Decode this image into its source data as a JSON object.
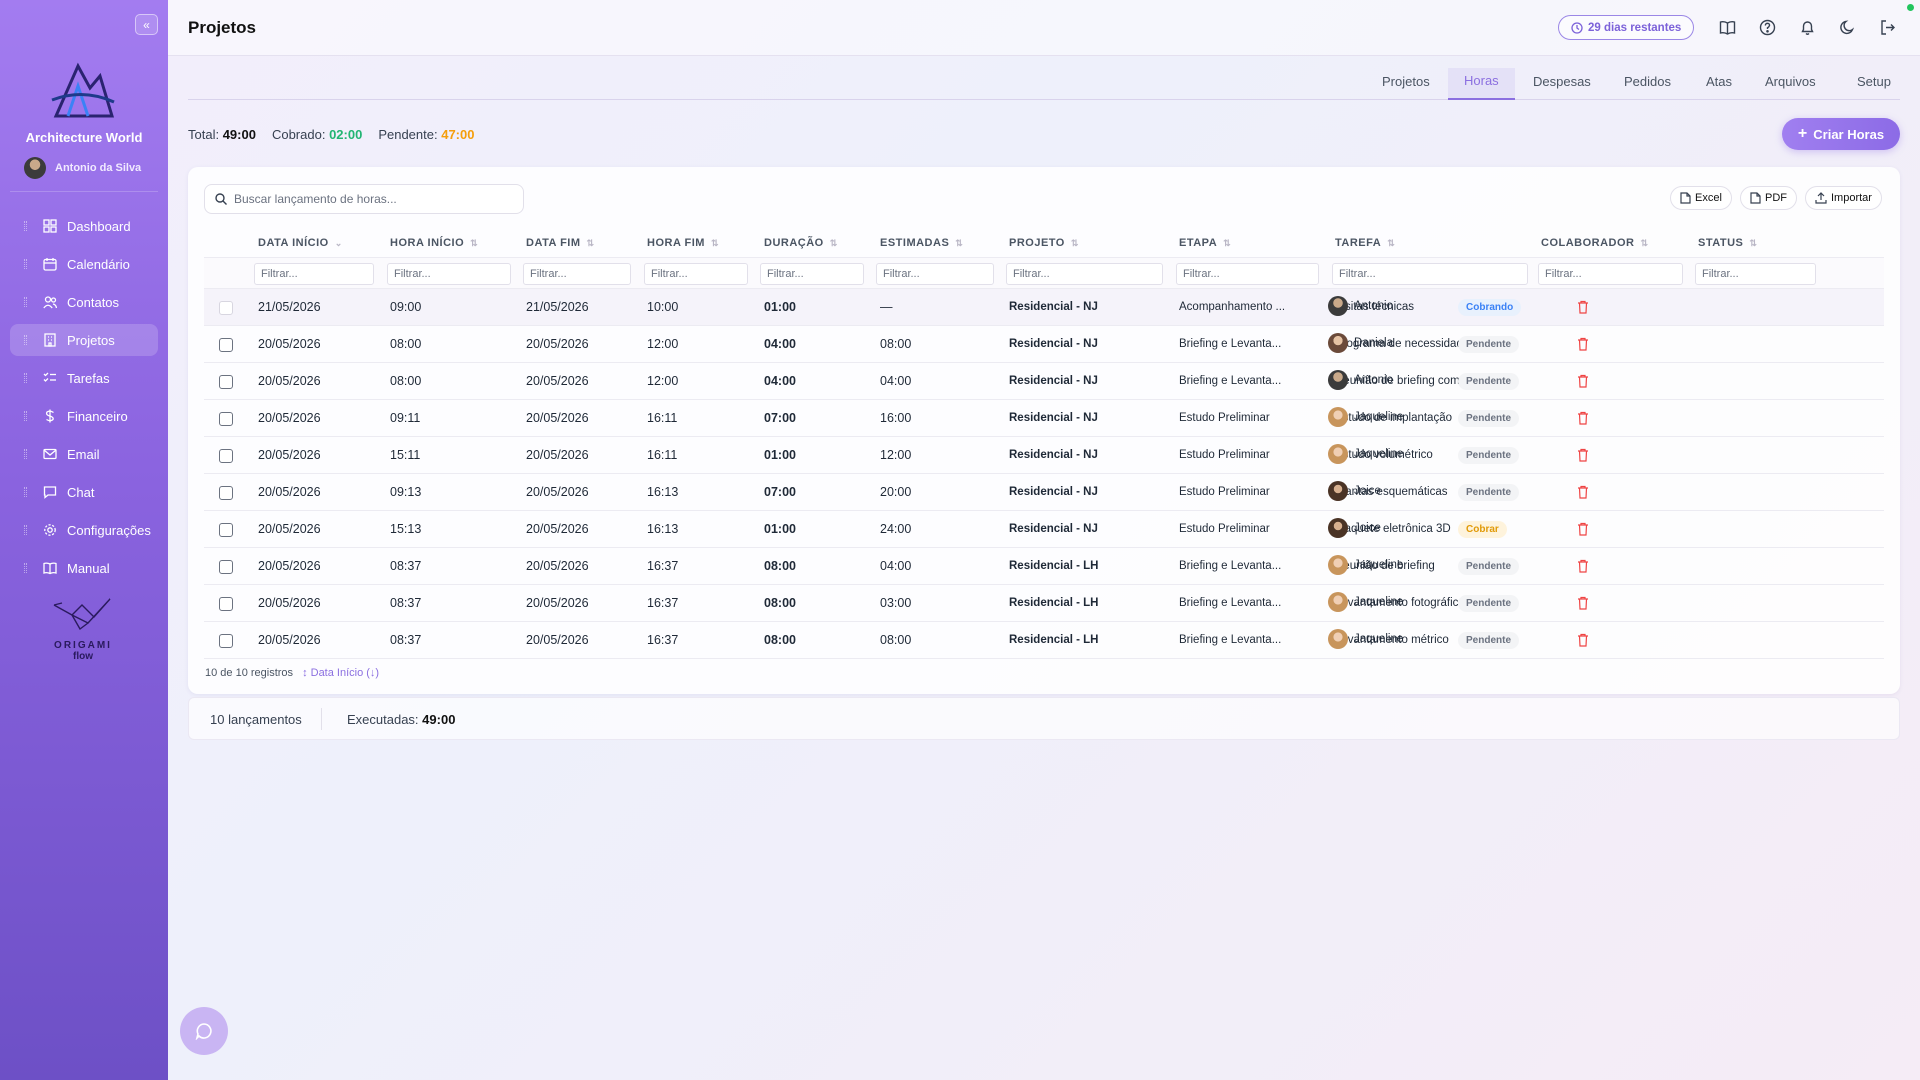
{
  "sidebar": {
    "brand": "Architecture World",
    "user": "Antonio da Silva",
    "items": [
      {
        "label": "Dashboard",
        "icon": "grid-icon"
      },
      {
        "label": "Calendário",
        "icon": "calendar-icon"
      },
      {
        "label": "Contatos",
        "icon": "users-icon"
      },
      {
        "label": "Projetos",
        "icon": "building-icon",
        "active": true
      },
      {
        "label": "Tarefas",
        "icon": "checklist-icon"
      },
      {
        "label": "Financeiro",
        "icon": "dollar-icon"
      },
      {
        "label": "Email",
        "icon": "mail-icon"
      },
      {
        "label": "Chat",
        "icon": "chat-icon"
      },
      {
        "label": "Configurações",
        "icon": "gear-icon"
      },
      {
        "label": "Manual",
        "icon": "book-icon"
      }
    ],
    "footer_logo_line1": "ORIGAMI",
    "footer_logo_line2": "flow"
  },
  "header": {
    "title": "Projetos",
    "trial": "29 dias restantes"
  },
  "tabs": [
    "Projetos",
    "Horas",
    "Despesas",
    "Pedidos",
    "Atas",
    "Arquivos",
    "Setup"
  ],
  "active_tab": "Horas",
  "summary": {
    "total_label": "Total:",
    "total": "49:00",
    "billed_label": "Cobrado:",
    "billed": "02:00",
    "pending_label": "Pendente:",
    "pending": "47:00"
  },
  "create_button": "Criar Horas",
  "search_placeholder": "Buscar lançamento de horas...",
  "export": {
    "excel": "Excel",
    "pdf": "PDF",
    "import": "Importar"
  },
  "columns": [
    "DATA INÍCIO",
    "HORA INÍCIO",
    "DATA FIM",
    "HORA FIM",
    "DURAÇÃO",
    "ESTIMADAS",
    "PROJETO",
    "ETAPA",
    "TAREFA",
    "COLABORADOR",
    "STATUS"
  ],
  "filter_placeholder": "Filtrar...",
  "rows": [
    {
      "data_inicio": "21/05/2026",
      "hora_inicio": "09:00",
      "data_fim": "21/05/2026",
      "hora_fim": "10:00",
      "duracao": "01:00",
      "estimadas": "—",
      "projeto": "Residencial - NJ",
      "etapa": "Acompanhamento ...",
      "tarefa": "Visitas técnicas",
      "colaborador": "Antonio",
      "status": "Cobrando"
    },
    {
      "data_inicio": "20/05/2026",
      "hora_inicio": "08:00",
      "data_fim": "20/05/2026",
      "hora_fim": "12:00",
      "duracao": "04:00",
      "estimadas": "08:00",
      "projeto": "Residencial - NJ",
      "etapa": "Briefing e Levanta...",
      "tarefa": "Programa de necessidades",
      "colaborador": "Daniela",
      "status": "Pendente"
    },
    {
      "data_inicio": "20/05/2026",
      "hora_inicio": "08:00",
      "data_fim": "20/05/2026",
      "hora_fim": "12:00",
      "duracao": "04:00",
      "estimadas": "04:00",
      "projeto": "Residencial - NJ",
      "etapa": "Briefing e Levanta...",
      "tarefa": "Reunião de briefing com cl...",
      "colaborador": "Antonio",
      "status": "Pendente"
    },
    {
      "data_inicio": "20/05/2026",
      "hora_inicio": "09:11",
      "data_fim": "20/05/2026",
      "hora_fim": "16:11",
      "duracao": "07:00",
      "estimadas": "16:00",
      "projeto": "Residencial - NJ",
      "etapa": "Estudo Preliminar",
      "tarefa": "Estudo de implantação",
      "colaborador": "Jaqueline",
      "status": "Pendente"
    },
    {
      "data_inicio": "20/05/2026",
      "hora_inicio": "15:11",
      "data_fim": "20/05/2026",
      "hora_fim": "16:11",
      "duracao": "01:00",
      "estimadas": "12:00",
      "projeto": "Residencial - NJ",
      "etapa": "Estudo Preliminar",
      "tarefa": "Estudo volumétrico",
      "colaborador": "Jaqueline",
      "status": "Pendente"
    },
    {
      "data_inicio": "20/05/2026",
      "hora_inicio": "09:13",
      "data_fim": "20/05/2026",
      "hora_fim": "16:13",
      "duracao": "07:00",
      "estimadas": "20:00",
      "projeto": "Residencial - NJ",
      "etapa": "Estudo Preliminar",
      "tarefa": "Plantas esquemáticas",
      "colaborador": "Joice",
      "status": "Pendente"
    },
    {
      "data_inicio": "20/05/2026",
      "hora_inicio": "15:13",
      "data_fim": "20/05/2026",
      "hora_fim": "16:13",
      "duracao": "01:00",
      "estimadas": "24:00",
      "projeto": "Residencial - NJ",
      "etapa": "Estudo Preliminar",
      "tarefa": "Maquete eletrônica 3D",
      "colaborador": "Joice",
      "status": "Cobrar"
    },
    {
      "data_inicio": "20/05/2026",
      "hora_inicio": "08:37",
      "data_fim": "20/05/2026",
      "hora_fim": "16:37",
      "duracao": "08:00",
      "estimadas": "04:00",
      "projeto": "Residencial - LH",
      "etapa": "Briefing e Levanta...",
      "tarefa": "Reunião de briefing",
      "colaborador": "Jaqueline",
      "status": "Pendente"
    },
    {
      "data_inicio": "20/05/2026",
      "hora_inicio": "08:37",
      "data_fim": "20/05/2026",
      "hora_fim": "16:37",
      "duracao": "08:00",
      "estimadas": "03:00",
      "projeto": "Residencial - LH",
      "etapa": "Briefing e Levanta...",
      "tarefa": "Levantamento fotográfico",
      "colaborador": "Jaqueline",
      "status": "Pendente"
    },
    {
      "data_inicio": "20/05/2026",
      "hora_inicio": "08:37",
      "data_fim": "20/05/2026",
      "hora_fim": "16:37",
      "duracao": "08:00",
      "estimadas": "08:00",
      "projeto": "Residencial - LH",
      "etapa": "Briefing e Levanta...",
      "tarefa": "Levantamento métrico",
      "colaborador": "Jaqueline",
      "status": "Pendente"
    }
  ],
  "table_footer": {
    "count": "10 de 10 registros",
    "sort": "↕ Data Início (↓)"
  },
  "bottom_bar": {
    "entries": "10 lançamentos",
    "executed_label": "Executadas:",
    "executed": "49:00"
  },
  "colors": {
    "accent": "#8b6fe0",
    "sidebar_top": "#a37cf0",
    "sidebar_bottom": "#6d50c6",
    "billed": "#22b573",
    "pending": "#f59e0b",
    "delete": "#ef4444"
  }
}
